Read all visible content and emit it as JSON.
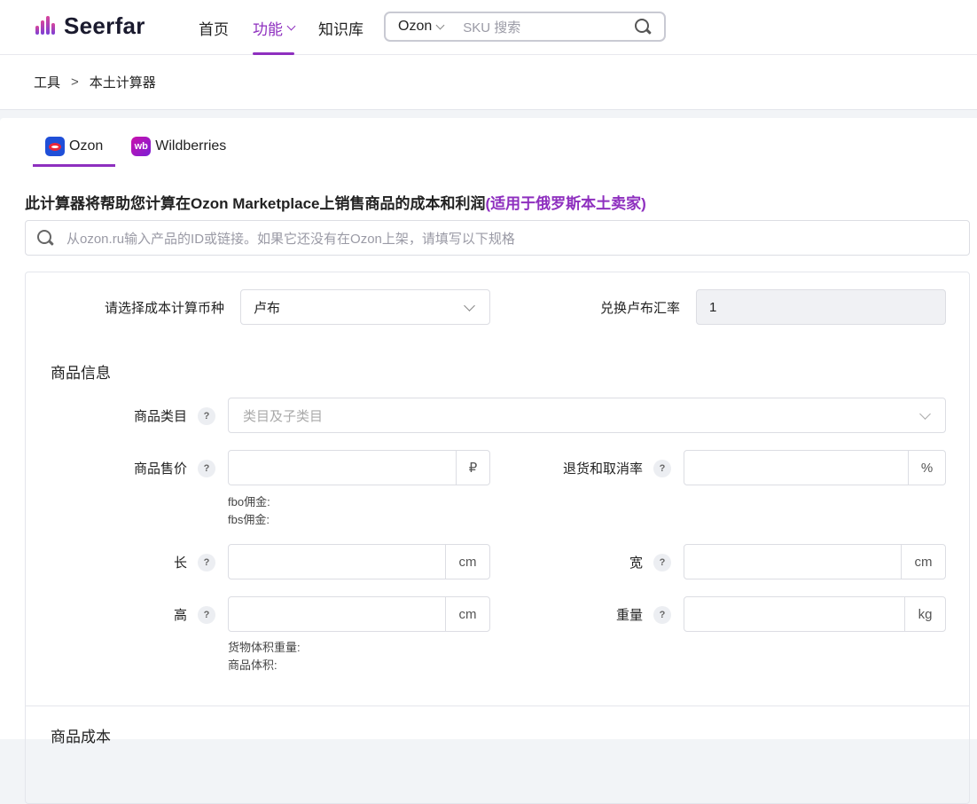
{
  "header": {
    "logo_text": "Seerfar",
    "nav": [
      {
        "label": "首页"
      },
      {
        "label": "功能"
      },
      {
        "label": "知识库"
      }
    ],
    "search": {
      "site": "Ozon",
      "placeholder": "SKU 搜索"
    }
  },
  "breadcrumb": {
    "items": [
      "工具",
      "本土计算器"
    ],
    "separator": ">"
  },
  "tabs": [
    {
      "label": "Ozon",
      "icon": "ozon-logo-icon"
    },
    {
      "label": "Wildberries",
      "icon": "wildberries-logo-icon",
      "icon_text": "wb"
    }
  ],
  "description": {
    "main": "此计算器将帮助您计算在Ozon Marketplace上销售商品的成本和利润",
    "highlight": "(适用于俄罗斯本土卖家)"
  },
  "product_search": {
    "placeholder": "从ozon.ru输入产品的ID或链接。如果它还没有在Ozon上架，请填写以下规格"
  },
  "form": {
    "currency": {
      "label": "请选择成本计算币种",
      "value": "卢布"
    },
    "exchange_rate": {
      "label": "兑换卢布汇率",
      "value": "1"
    },
    "product_info_title": "商品信息",
    "category": {
      "label": "商品类目",
      "help": "?",
      "placeholder": "类目及子类目"
    },
    "price": {
      "label": "商品售价",
      "help": "?",
      "unit": "₽",
      "value": ""
    },
    "return_rate": {
      "label": "退货和取消率",
      "help": "?",
      "unit": "%",
      "value": ""
    },
    "commission_notes": [
      "fbo佣金:",
      "fbs佣金:"
    ],
    "length": {
      "label": "长",
      "help": "?",
      "unit": "cm",
      "value": ""
    },
    "width": {
      "label": "宽",
      "help": "?",
      "unit": "cm",
      "value": ""
    },
    "height": {
      "label": "高",
      "help": "?",
      "unit": "cm",
      "value": ""
    },
    "weight": {
      "label": "重量",
      "help": "?",
      "unit": "kg",
      "value": ""
    },
    "volume_notes": [
      "货物体积重量:",
      "商品体积:"
    ],
    "product_cost_title": "商品成本"
  },
  "colors": {
    "accent": "#8e2fbf",
    "ozon_blue": "#1f4fd8",
    "wb_purple": "#cb11ab"
  }
}
